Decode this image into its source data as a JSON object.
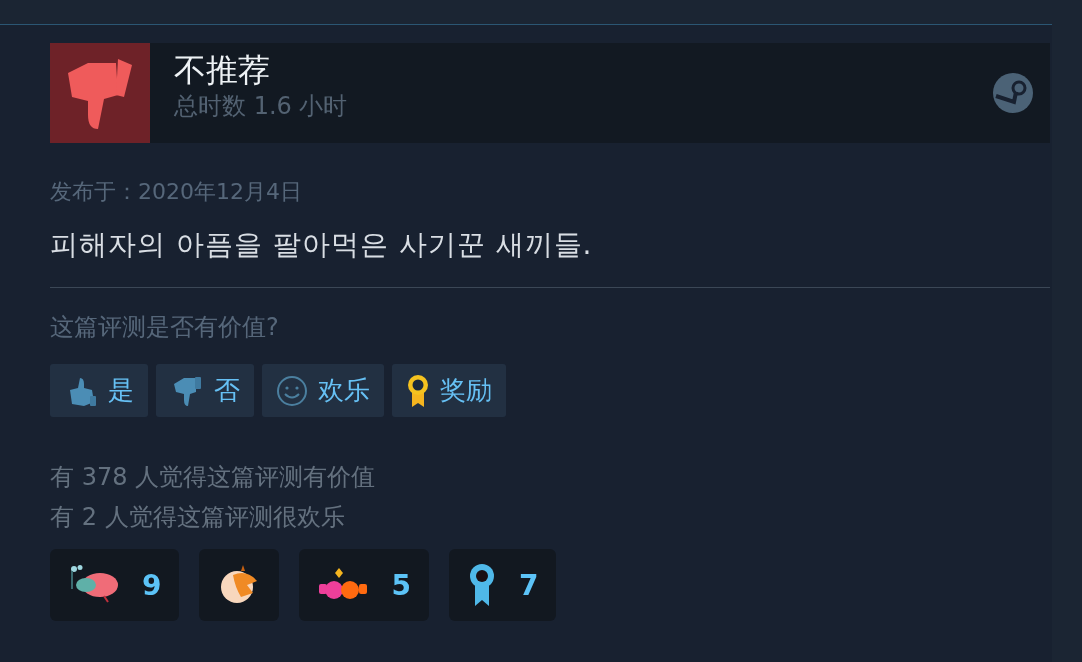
{
  "review": {
    "verdict": "不推荐",
    "playtime": "总时数 1.6 小时",
    "posted": "发布于：2020年12月4日",
    "text": "피해자의 아픔을 팔아먹은 사기꾼 새끼들.",
    "question": "这篇评测是否有价值?",
    "buttons": [
      {
        "label": "是",
        "kind": "thumbs-up"
      },
      {
        "label": "否",
        "kind": "thumbs-down"
      },
      {
        "label": "欢乐",
        "kind": "smile"
      },
      {
        "label": "奖励",
        "kind": "award"
      }
    ],
    "stats": [
      "有 378 人觉得这篇评测有价值",
      "有 2 人觉得这篇评测很欢乐"
    ],
    "awards": [
      {
        "kind": "snorkel",
        "count": "9"
      },
      {
        "kind": "critter"
      },
      {
        "kind": "gems",
        "count": "5"
      },
      {
        "kind": "ribbon",
        "count": "7"
      }
    ]
  }
}
